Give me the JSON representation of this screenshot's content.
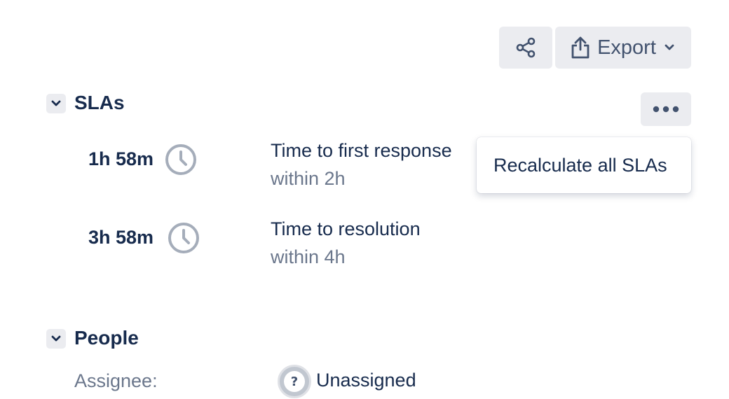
{
  "toolbar": {
    "share_icon": "share-icon",
    "export_label": "Export",
    "export_icon": "export-icon",
    "export_chevron_icon": "chevron-down-icon",
    "more_icon": "more-horizontal-icon"
  },
  "slas_section": {
    "title": "SLAs",
    "toggle_icon": "chevron-down-icon",
    "items": [
      {
        "remaining": "1h 58m",
        "icon": "clock-icon",
        "name": "Time to first response",
        "goal": "within 2h"
      },
      {
        "remaining": "3h 58m",
        "icon": "clock-icon",
        "name": "Time to resolution",
        "goal": "within 4h"
      }
    ]
  },
  "more_menu": {
    "items": [
      {
        "label": "Recalculate all SLAs"
      }
    ]
  },
  "people_section": {
    "title": "People",
    "toggle_icon": "chevron-down-icon",
    "assignee_label": "Assignee:",
    "assignee_value": "Unassigned",
    "assignee_avatar_glyph": "?"
  },
  "colors": {
    "text_primary": "#172b4d",
    "text_subtle": "#6b778c",
    "button_bg": "#ebecf0",
    "icon_gray": "#a5adba"
  }
}
